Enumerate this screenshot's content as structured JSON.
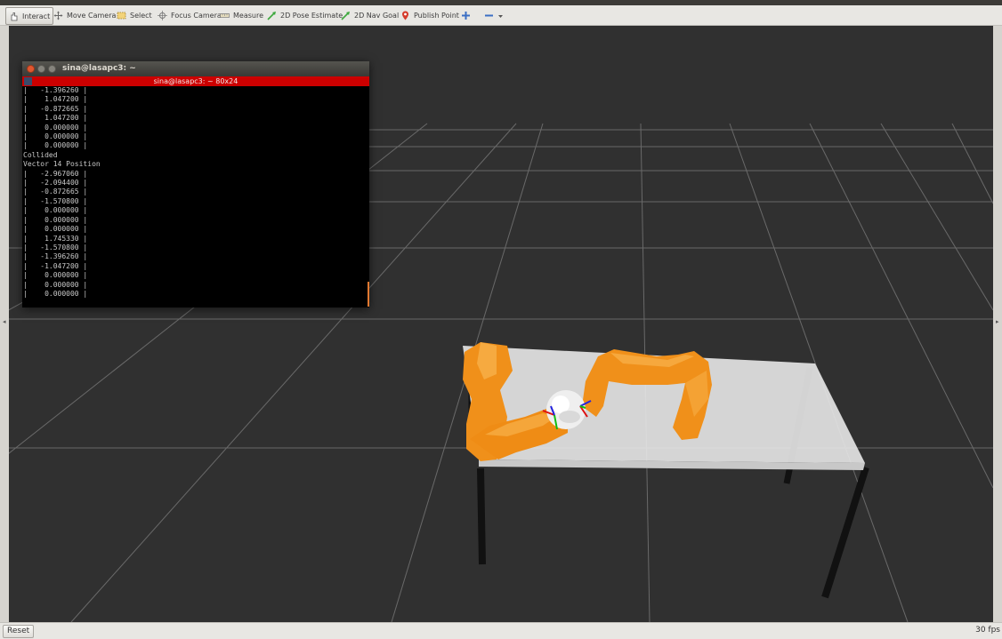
{
  "toolbar": {
    "tools": [
      {
        "label": "Interact",
        "icon": "interact-icon"
      },
      {
        "label": "Move Camera",
        "icon": "move-camera-icon"
      },
      {
        "label": "Select",
        "icon": "select-icon"
      },
      {
        "label": "Focus Camera",
        "icon": "focus-camera-icon"
      },
      {
        "label": "Measure",
        "icon": "measure-icon"
      },
      {
        "label": "2D Pose Estimate",
        "icon": "pose-arrow-icon"
      },
      {
        "label": "2D Nav Goal",
        "icon": "nav-goal-arrow-icon"
      },
      {
        "label": "Publish Point",
        "icon": "map-pin-icon"
      }
    ],
    "active_tool": "Interact"
  },
  "terminal": {
    "window_title": "sina@lasapc3: ~",
    "tab_title": "sina@lasapc3: ~ 80x24",
    "lines": [
      "|   -1.396260 |",
      "|    1.047200 |",
      "|   -0.872665 |",
      "|    1.047200 |",
      "|    0.000000 |",
      "|    0.000000 |",
      "|    0.000000 |",
      "Collided",
      "Vector 14 Position",
      "|   -2.967060 |",
      "|   -2.094400 |",
      "|   -0.872665 |",
      "|   -1.570800 |",
      "|    0.000000 |",
      "|    0.000000 |",
      "|    0.000000 |",
      "|    1.745330 |",
      "|   -1.570800 |",
      "|   -1.396260 |",
      "|   -1.047200 |",
      "|    0.000000 |",
      "|    0.000000 |",
      "|    0.000000 |"
    ]
  },
  "statusbar": {
    "reset_label": "Reset",
    "fps_label": "30 fps"
  },
  "colors": {
    "viewport_bg": "#303030",
    "robot_arm": "#f0901a",
    "terminal_tab": "#cc0000",
    "table_top": "#e4e4e4"
  }
}
